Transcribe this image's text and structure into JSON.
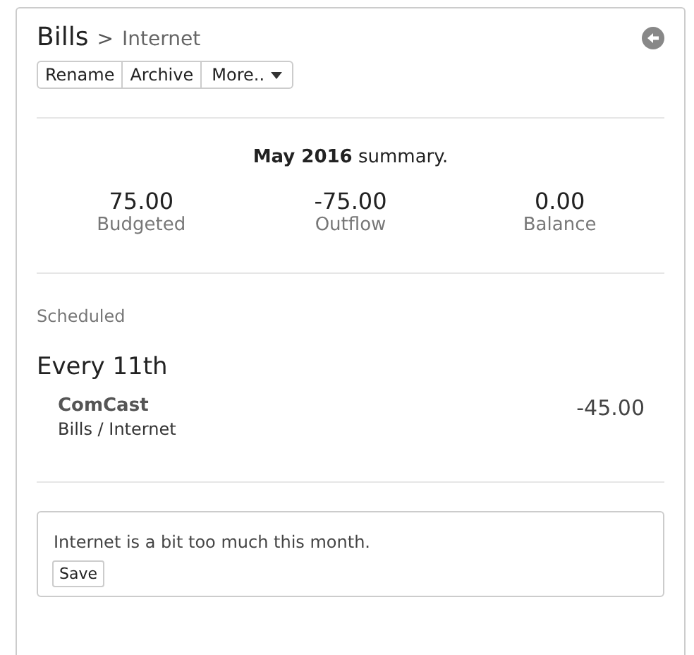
{
  "breadcrumb": {
    "parent": "Bills",
    "separator": ">",
    "current": "Internet"
  },
  "toolbar": [
    {
      "label": "Rename",
      "kind": "plain"
    },
    {
      "label": "Archive",
      "kind": "plain"
    },
    {
      "label": "More..",
      "kind": "dropdown"
    }
  ],
  "summary": {
    "title": "**May 2016** summary.",
    "stats": [
      {
        "value": "75.00",
        "label": "Budgeted"
      },
      {
        "value": "-75.00",
        "label": "Outflow"
      },
      {
        "value": "0.00",
        "label": "Balance"
      }
    ]
  },
  "scheduled": {
    "heading": "Scheduled",
    "groups": [
      {
        "title": "Every 11th",
        "items": [
          {
            "payee": "ComCast",
            "category": "Bills / Internet",
            "amount": "-45.00"
          }
        ]
      }
    ]
  },
  "note": {
    "value": "Internet is a bit too much this month.",
    "button": "Save"
  }
}
